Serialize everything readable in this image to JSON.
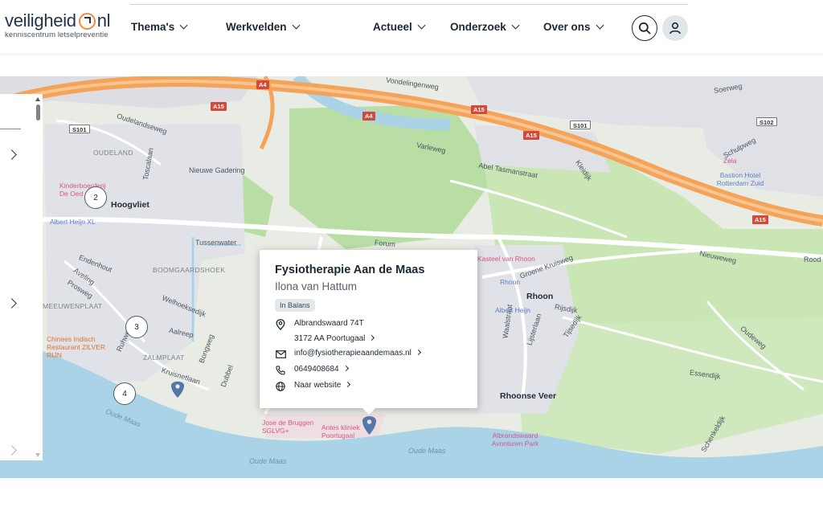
{
  "logo": {
    "word_left": "veiligheid",
    "word_right": "nl",
    "subtitle": "kenniscentrum letselpreventie"
  },
  "nav": [
    {
      "label": "Thema's"
    },
    {
      "label": "Werkvelden"
    },
    {
      "label": "Actueel"
    },
    {
      "label": "Onderzoek"
    },
    {
      "label": "Over ons"
    }
  ],
  "icons": {
    "search": "search-icon",
    "account": "user-icon",
    "pin": "location-pin-icon",
    "mail": "mail-icon",
    "phone": "phone-icon",
    "web": "globe-icon"
  },
  "colors": {
    "accent": "#f08a3c",
    "motorway": "#f4a45a",
    "water": "#aad3e8",
    "pin": "#5476a8"
  },
  "map": {
    "places": [
      "Hoogvliet",
      "Rhoon",
      "Rhoonse Veer",
      "OUDELAND",
      "BOOMGAARDSHOEK",
      "MEEUWENPLAAT",
      "ZALMPLAAT",
      "Nieuwe Gadering",
      "Tussenwater"
    ],
    "streets": [
      "Vondelingenweg",
      "Oudelandseweg",
      "Toscalaan",
      "Varleweg",
      "Abel Tasmanstraat",
      "Kleidijk",
      "Schulpweg",
      "Soerweg",
      "Groene Kruisweg",
      "Nieuweweg",
      "Rijsdijk",
      "Essendijk",
      "Oudeweg",
      "Waalstraat",
      "Lijsterlaan",
      "Tijsedijk",
      "Endenhout",
      "Aveling",
      "Prosweg",
      "Welhoeksedijk",
      "Aalreep",
      "Ruhweg",
      "Bongweg",
      "Dubbel",
      "Kruisnetlaan",
      "Schenkeldijk",
      "Forum",
      "Rood"
    ],
    "water": [
      "Oude Maas",
      "Oude Maas",
      "Oude Maas"
    ],
    "pois": [
      "Kinderboerderij De Oed",
      "Albert Heijn XL",
      "Chinees Indisch Restaurant ZILVER RIJN",
      "Albert Heijn",
      "Rhoon",
      "Kasteel van Rhoon",
      "Bastion Hotel Rotterdam Zuid",
      "Zela",
      "Albrandswaard Avonturen Park",
      "Jose de Bruggen SGLVG+",
      "Antes kliniek Poortugaal"
    ],
    "shields": [
      "S101",
      "A15",
      "A4",
      "A4",
      "S101",
      "A15",
      "S102",
      "A15",
      "A15"
    ],
    "clusters": [
      {
        "count": "2"
      },
      {
        "count": "3"
      },
      {
        "count": "4"
      }
    ]
  },
  "popup": {
    "name": "Fysiotherapie Aan de Maas",
    "person": "Ilona van Hattum",
    "badge": "In Balans",
    "address_line1": "Albrandswaard 74T",
    "address_line2": "3172 AA Poortugaal",
    "email": "info@fysiotherapieaandemaas.nl",
    "phone": "0649408684",
    "website": "Naar website"
  }
}
